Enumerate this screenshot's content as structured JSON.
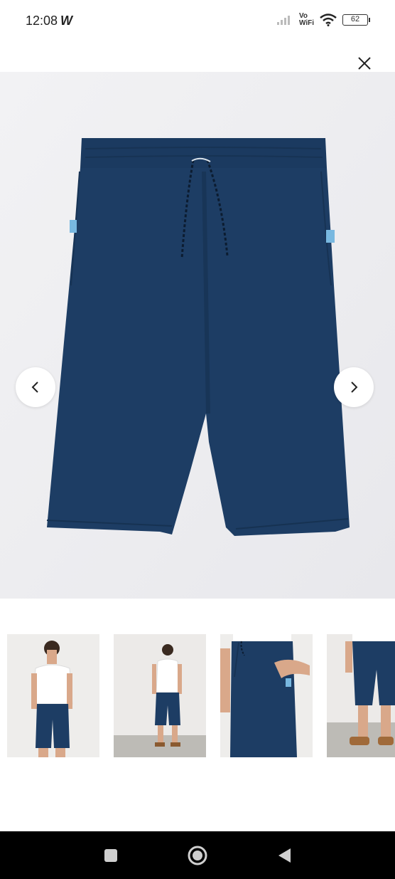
{
  "status_bar": {
    "time": "12:08",
    "w_indicator": "W",
    "network_label_top": "Vo",
    "network_label_bottom": "WiFi",
    "battery": "62"
  },
  "viewer": {
    "close_icon": "close-icon",
    "prev_icon": "chevron-left-icon",
    "next_icon": "chevron-right-icon",
    "product_color": "#1d3d64"
  },
  "thumbnails": [
    {
      "name": "model-front-view"
    },
    {
      "name": "model-full-length-view"
    },
    {
      "name": "pocket-closeup-view"
    },
    {
      "name": "legs-closeup-view"
    }
  ],
  "nav_bar": {
    "recents_icon": "square-icon",
    "home_icon": "circle-icon",
    "back_icon": "triangle-back-icon"
  }
}
